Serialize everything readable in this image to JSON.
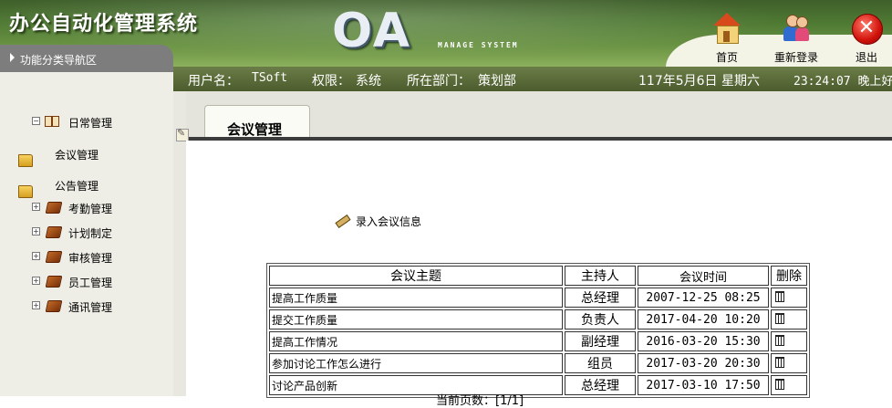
{
  "header": {
    "system_title": "办公自动化管理系统",
    "logo": "OA",
    "logo_sub": "MANAGE SYSTEM",
    "home_label": "首页",
    "relogin_label": "重新登录",
    "exit_label": "退出"
  },
  "infobar": {
    "user_label": "用户名：",
    "user_value": "TSoft",
    "perm_label": "权限：",
    "perm_value": "系统",
    "dept_label": "所在部门：",
    "dept_value": "策划部",
    "date": "117年5月6日 星期六",
    "time": "23:24:07 晚上好"
  },
  "sidebar": {
    "title": "功能分类导航区",
    "items": [
      {
        "label": "日常管理",
        "icon": "open-book-icon"
      },
      {
        "label": "会议管理",
        "icon": "folder-icon"
      },
      {
        "label": "公告管理",
        "icon": "folder-icon"
      },
      {
        "label": "考勤管理",
        "icon": "book-icon"
      },
      {
        "label": "计划制定",
        "icon": "book-icon"
      },
      {
        "label": "审核管理",
        "icon": "book-icon"
      },
      {
        "label": "员工管理",
        "icon": "book-icon"
      },
      {
        "label": "通讯管理",
        "icon": "book-icon"
      }
    ]
  },
  "content": {
    "tab_label": "会议管理",
    "add_link": "录入会议信息",
    "table": {
      "headers": [
        "会议主题",
        "主持人",
        "会议时间",
        "删除"
      ],
      "rows": [
        {
          "topic": "提高工作质量",
          "host": "总经理",
          "time": "2007-12-25 08:25"
        },
        {
          "topic": "提交工作质量",
          "host": "负责人",
          "time": "2017-04-20 10:20"
        },
        {
          "topic": "提高工作情况",
          "host": "副经理",
          "time": "2016-03-20 15:30"
        },
        {
          "topic": "参加讨论工作怎么进行",
          "host": "组员",
          "time": "2017-03-20 20:30"
        },
        {
          "topic": "讨论产品创新",
          "host": "总经理",
          "time": "2017-03-10 17:50"
        }
      ]
    },
    "pager": "当前页数：[1/1]"
  }
}
